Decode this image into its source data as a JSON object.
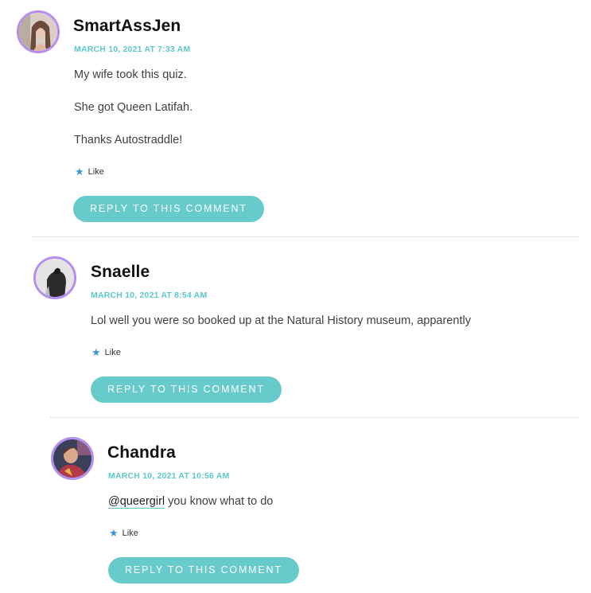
{
  "comments": [
    {
      "author": "SmartAssJen",
      "date": "MARCH 10, 2021 AT 7:33 AM",
      "paragraphs": [
        "My wife took this quiz.",
        "She got Queen Latifah.",
        "Thanks Autostraddle!"
      ],
      "like_label": "Like",
      "reply_label": "REPLY TO THIS COMMENT"
    },
    {
      "author": "Snaelle",
      "date": "MARCH 10, 2021 AT 8:54 AM",
      "paragraphs": [
        "Lol well you were so booked up at the Natural History museum, apparently"
      ],
      "like_label": "Like",
      "reply_label": "REPLY TO THIS COMMENT"
    },
    {
      "author": "Chandra",
      "date": "MARCH 10, 2021 AT 10:56 AM",
      "mention": "@queergirl",
      "text_after_mention": " you know what to do",
      "like_label": "Like",
      "reply_label": "REPLY TO THIS COMMENT"
    }
  ],
  "colors": {
    "accent": "#68cbcb",
    "date": "#5cc8c8",
    "avatar_border": "#b58ff0",
    "like_star": "#3b96d4"
  },
  "icons": {
    "like": "star-icon"
  }
}
